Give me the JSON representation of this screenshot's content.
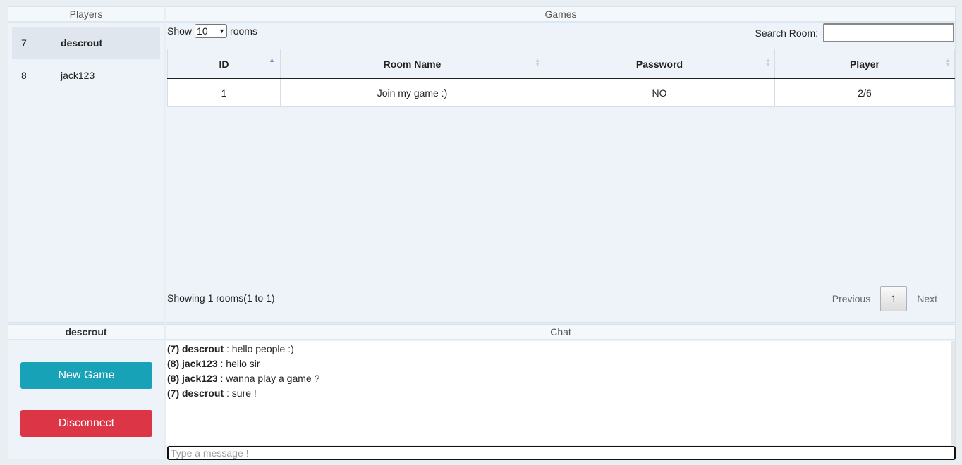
{
  "players": {
    "title": "Players",
    "items": [
      {
        "id": "7",
        "name": "descrout",
        "active": true
      },
      {
        "id": "8",
        "name": "jack123",
        "active": false
      }
    ]
  },
  "games": {
    "title": "Games",
    "show_label": "Show",
    "show_value": "10",
    "rooms_label": "rooms",
    "search_label": "Search Room:",
    "columns": [
      "ID",
      "Room Name",
      "Password",
      "Player"
    ],
    "rows": [
      {
        "id": "1",
        "room_name": "Join my game :)",
        "password": "NO",
        "player": "2/6"
      }
    ],
    "info": "Showing 1 rooms(1 to 1)",
    "pager": {
      "previous": "Previous",
      "current": "1",
      "next": "Next"
    }
  },
  "user": {
    "name": "descrout",
    "new_game_label": "New Game",
    "disconnect_label": "Disconnect",
    "new_game_color": "#17a2b8",
    "disconnect_color": "#dc3545"
  },
  "chat": {
    "title": "Chat",
    "messages": [
      {
        "sender": "(7) descrout",
        "text": " : hello people :)"
      },
      {
        "sender": "(8) jack123",
        "text": " : hello sir"
      },
      {
        "sender": "(8) jack123",
        "text": " : wanna play a game ?"
      },
      {
        "sender": "(7) descrout",
        "text": " : sure !"
      }
    ],
    "placeholder": "Type a message !"
  }
}
